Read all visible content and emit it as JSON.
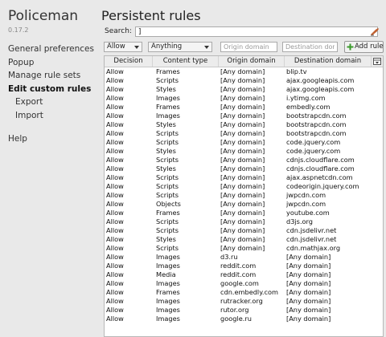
{
  "app": {
    "title": "Policeman",
    "version": "0.17.2"
  },
  "nav": [
    {
      "label": "General preferences",
      "level": 0,
      "active": false
    },
    {
      "label": "Popup",
      "level": 0,
      "active": false
    },
    {
      "label": "Manage rule sets",
      "level": 0,
      "active": false
    },
    {
      "label": "Edit custom rules",
      "level": 0,
      "active": true
    },
    {
      "label": "Export",
      "level": 1,
      "active": false
    },
    {
      "label": "Import",
      "level": 1,
      "active": false
    },
    {
      "label": "Help",
      "level": 0,
      "active": false,
      "gap": true
    }
  ],
  "main": {
    "title": "Persistent rules"
  },
  "search": {
    "label": "Search:",
    "value": "]"
  },
  "filters": {
    "decision": "Allow",
    "content_type": "Anything",
    "origin_placeholder": "Origin domain",
    "destination_placeholder": "Destination dor",
    "add_rule_label": "Add rule"
  },
  "table": {
    "headers": [
      "Decision",
      "Content type",
      "Origin domain",
      "Destination domain"
    ],
    "rows": [
      [
        "Allow",
        "Frames",
        "[Any domain]",
        "blip.tv"
      ],
      [
        "Allow",
        "Scripts",
        "[Any domain]",
        "ajax.googleapis.com"
      ],
      [
        "Allow",
        "Styles",
        "[Any domain]",
        "ajax.googleapis.com"
      ],
      [
        "Allow",
        "Images",
        "[Any domain]",
        "i.ytimg.com"
      ],
      [
        "Allow",
        "Frames",
        "[Any domain]",
        "embedly.com"
      ],
      [
        "Allow",
        "Images",
        "[Any domain]",
        "bootstrapcdn.com"
      ],
      [
        "Allow",
        "Styles",
        "[Any domain]",
        "bootstrapcdn.com"
      ],
      [
        "Allow",
        "Scripts",
        "[Any domain]",
        "bootstrapcdn.com"
      ],
      [
        "Allow",
        "Scripts",
        "[Any domain]",
        "code.jquery.com"
      ],
      [
        "Allow",
        "Styles",
        "[Any domain]",
        "code.jquery.com"
      ],
      [
        "Allow",
        "Scripts",
        "[Any domain]",
        "cdnjs.cloudflare.com"
      ],
      [
        "Allow",
        "Styles",
        "[Any domain]",
        "cdnjs.cloudflare.com"
      ],
      [
        "Allow",
        "Scripts",
        "[Any domain]",
        "ajax.aspnetcdn.com"
      ],
      [
        "Allow",
        "Scripts",
        "[Any domain]",
        "codeorigin.jquery.com"
      ],
      [
        "Allow",
        "Scripts",
        "[Any domain]",
        "jwpcdn.com"
      ],
      [
        "Allow",
        "Objects",
        "[Any domain]",
        "jwpcdn.com"
      ],
      [
        "Allow",
        "Frames",
        "[Any domain]",
        "youtube.com"
      ],
      [
        "Allow",
        "Scripts",
        "[Any domain]",
        "d3js.org"
      ],
      [
        "Allow",
        "Scripts",
        "[Any domain]",
        "cdn.jsdelivr.net"
      ],
      [
        "Allow",
        "Styles",
        "[Any domain]",
        "cdn.jsdelivr.net"
      ],
      [
        "Allow",
        "Scripts",
        "[Any domain]",
        "cdn.mathjax.org"
      ],
      [
        "Allow",
        "Images",
        "d3.ru",
        "[Any domain]"
      ],
      [
        "Allow",
        "Images",
        "reddit.com",
        "[Any domain]"
      ],
      [
        "Allow",
        "Media",
        "reddit.com",
        "[Any domain]"
      ],
      [
        "Allow",
        "Images",
        "google.com",
        "[Any domain]"
      ],
      [
        "Allow",
        "Frames",
        "cdn.embedly.com",
        "[Any domain]"
      ],
      [
        "Allow",
        "Images",
        "rutracker.org",
        "[Any domain]"
      ],
      [
        "Allow",
        "Images",
        "rutor.org",
        "[Any domain]"
      ],
      [
        "Allow",
        "Images",
        "google.ru",
        "[Any domain]"
      ]
    ]
  },
  "icons": {
    "search_clear": "clear-search-icon",
    "add_rule": "plus-icon",
    "column_picker": "column-picker-icon"
  },
  "colors": {
    "add_icon": "#3a9a2a",
    "clear_icon": "#c06030"
  }
}
